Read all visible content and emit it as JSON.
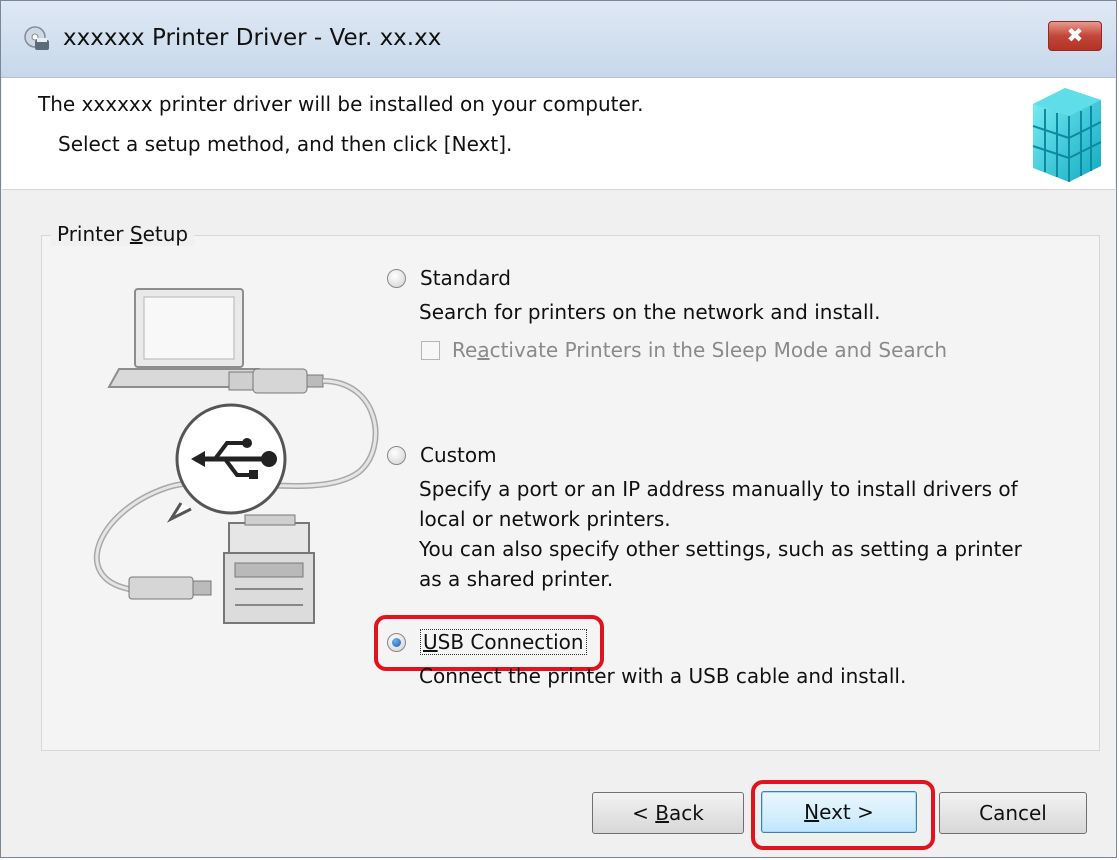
{
  "window": {
    "title": "xxxxxx Printer Driver - Ver. xx.xx",
    "close_label": "✖",
    "icons": [
      "printer-cd-icon",
      "package-cube-icon",
      "close-icon"
    ]
  },
  "header": {
    "line1": "The xxxxxx printer driver will be installed on your computer.",
    "line2": "Select a setup method, and then click [Next]."
  },
  "group": {
    "title_prefix": "Printer ",
    "title_accel": "S",
    "title_suffix": "etup"
  },
  "options": {
    "standard": {
      "label": "Standard",
      "selected": false,
      "desc": "Search for printers on the network and install.",
      "checkbox_pre": "Re",
      "checkbox_accel": "a",
      "checkbox_post": "ctivate Printers in the Sleep Mode and Search",
      "checkbox_checked": false,
      "checkbox_enabled": false
    },
    "custom": {
      "label": "Custom",
      "selected": false,
      "desc1": "Specify a port or an IP address manually to install drivers of",
      "desc2": "local or network printers.",
      "desc3": "You can also specify other settings, such as setting a printer",
      "desc4": "as a shared printer."
    },
    "usb": {
      "label_accel": "U",
      "label_rest": "SB Connection",
      "selected": true,
      "desc": "Connect the printer with a USB cable and install."
    }
  },
  "buttons": {
    "back_pre": "< ",
    "back_accel": "B",
    "back_post": "ack",
    "next_accel": "N",
    "next_post": "ext >",
    "cancel": "Cancel"
  },
  "highlight_color": "#e0141e"
}
